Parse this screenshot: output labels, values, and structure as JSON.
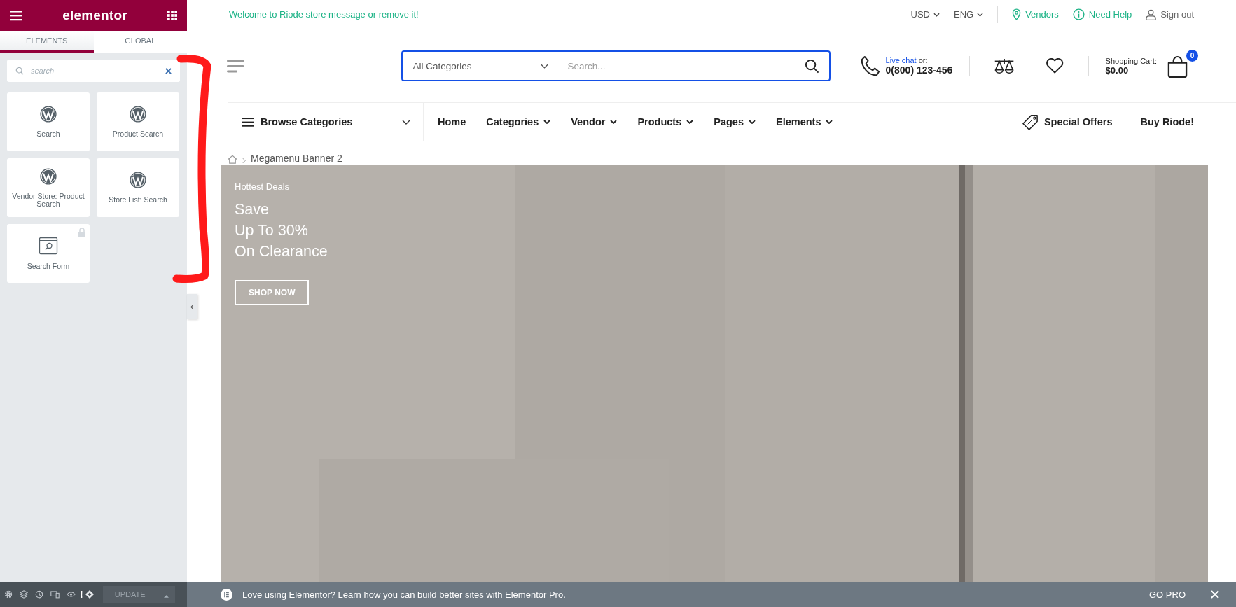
{
  "editor_panel": {
    "logo": "elementor",
    "tabs": [
      {
        "label": "ELEMENTS",
        "selected": true
      },
      {
        "label": "GLOBAL",
        "selected": false
      }
    ],
    "search": {
      "placeholder": "search"
    },
    "widgets": [
      {
        "label": "Search",
        "kind": "wordpress",
        "locked": false
      },
      {
        "label": "Product Search",
        "kind": "wordpress",
        "locked": false
      },
      {
        "label": "Vendor Store: Product Search",
        "kind": "wordpress",
        "locked": false
      },
      {
        "label": "Store List: Search",
        "kind": "wordpress",
        "locked": false
      },
      {
        "label": "Search Form",
        "kind": "search-form",
        "locked": true
      }
    ],
    "toolbar": {
      "alert": "!",
      "update_button": "UPDATE"
    }
  },
  "top_bar": {
    "welcome": "Welcome to Riode store message or remove it!",
    "currency": "USD",
    "language": "ENG",
    "links": [
      {
        "label": "Vendors",
        "kind": "pin"
      },
      {
        "label": "Need Help",
        "kind": "info"
      },
      {
        "label": "Sign out",
        "kind": "user"
      }
    ]
  },
  "header": {
    "category_select": "All Categories",
    "search": {
      "placeholder": "Search..."
    },
    "contact": {
      "link": "Live chat",
      "note": "or:",
      "phone": "0(800) 123-456"
    },
    "cart": {
      "label": "Shopping Cart:",
      "total": "$0.00",
      "count": "0"
    }
  },
  "nav": {
    "browse": "Browse Categories",
    "items": [
      {
        "label": "Home",
        "has_menu": false
      },
      {
        "label": "Categories",
        "has_menu": true
      },
      {
        "label": "Vendor",
        "has_menu": true
      },
      {
        "label": "Products",
        "has_menu": true
      },
      {
        "label": "Pages",
        "has_menu": true
      },
      {
        "label": "Elements",
        "has_menu": true
      }
    ],
    "extras": [
      {
        "label": "Special Offers",
        "kind": "tag"
      },
      {
        "label": "Buy Riode!",
        "kind": "plain"
      }
    ]
  },
  "breadcrumb": {
    "current": "Megamenu Banner 2"
  },
  "banner": {
    "kind": "picture",
    "eyebrow": "Hottest Deals",
    "headline": [
      "Save",
      "Up To 30%",
      "On Clearance"
    ],
    "button": "SHOP NOW"
  },
  "notice": {
    "text": "Love using Elementor?",
    "link": "Learn how you can build better sites with Elementor Pro.",
    "action": "GO PRO"
  }
}
